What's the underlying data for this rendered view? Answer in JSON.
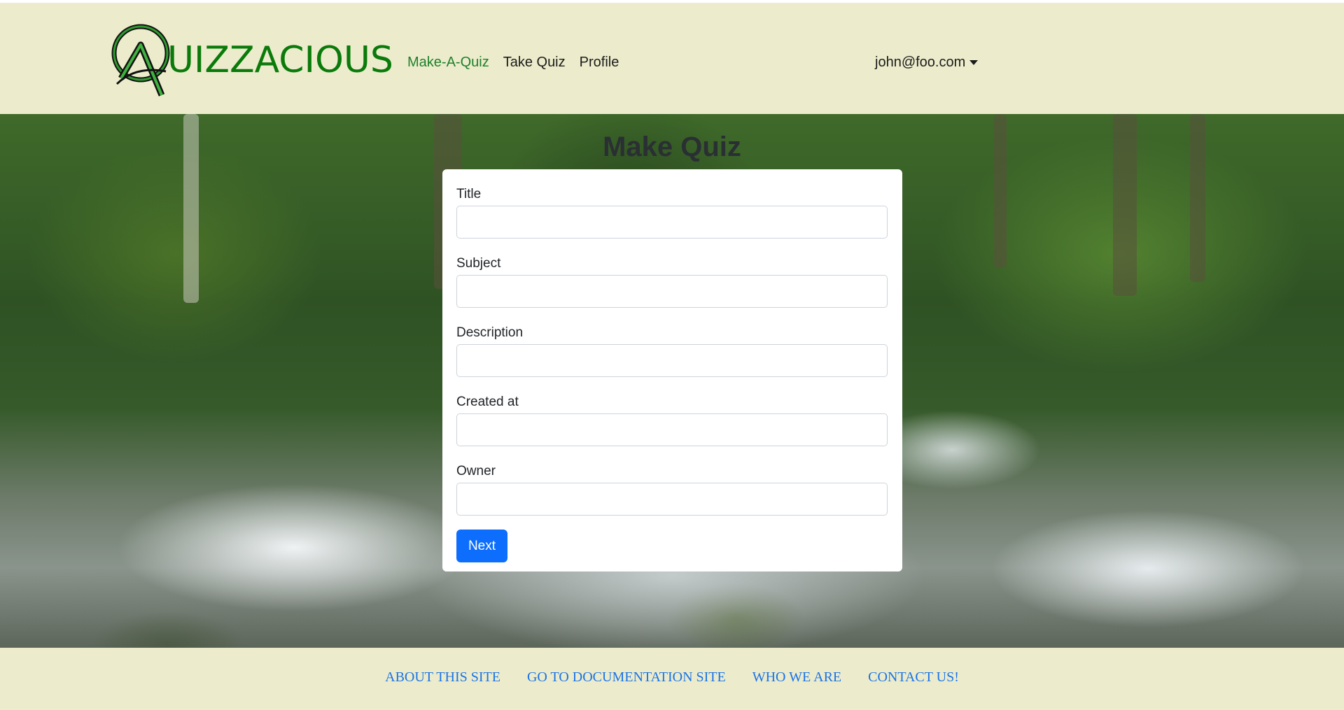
{
  "brand": {
    "name": "UIZZACIOUS",
    "logo_icon": "quizzacious-logo-icon",
    "color": "#0a7a0a"
  },
  "nav": {
    "items": [
      {
        "label": "Make-A-Quiz",
        "active": true
      },
      {
        "label": "Take Quiz",
        "active": false
      },
      {
        "label": "Profile",
        "active": false
      }
    ],
    "user": "john@foo.com"
  },
  "page": {
    "title": "Make Quiz"
  },
  "form": {
    "fields": [
      {
        "label": "Title",
        "value": ""
      },
      {
        "label": "Subject",
        "value": ""
      },
      {
        "label": "Description",
        "value": ""
      },
      {
        "label": "Created at",
        "value": ""
      },
      {
        "label": "Owner",
        "value": ""
      }
    ],
    "submit_label": "Next"
  },
  "footer": {
    "links": [
      "ABOUT THIS SITE",
      "GO TO DOCUMENTATION SITE",
      "WHO WE ARE",
      "CONTACT US!"
    ]
  },
  "colors": {
    "header_bg": "#ececcc",
    "primary_button": "#0d6efd",
    "footer_link": "#1a73e8"
  }
}
